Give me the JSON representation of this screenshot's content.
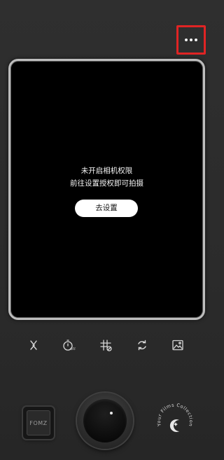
{
  "top_bar": {
    "more_icon": "more-dots-icon",
    "highlight_color": "#e02424"
  },
  "viewfinder": {
    "permission_line1": "未开启相机权限",
    "permission_line2": "前往设置授权即可拍摄",
    "settings_button": "去设置"
  },
  "toolbar": [
    {
      "icon": "flash-off-icon"
    },
    {
      "icon": "timer-off-icon"
    },
    {
      "icon": "grid-off-icon"
    },
    {
      "icon": "switch-camera-icon"
    },
    {
      "icon": "gallery-icon"
    }
  ],
  "bottom": {
    "film_label": "FOMZ",
    "collection_text": "Your Films Collection",
    "collection_icon": "moon-star-icon"
  }
}
